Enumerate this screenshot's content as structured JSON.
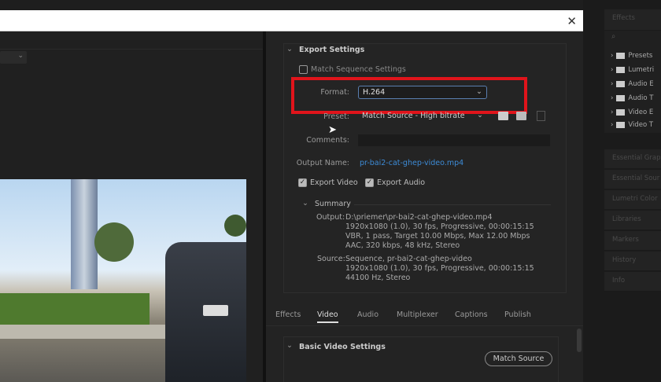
{
  "dialog": {
    "close_icon": "close-icon"
  },
  "export_settings": {
    "title": "Export Settings",
    "match_sequence": "Match Sequence Settings",
    "format_label": "Format:",
    "format_value": "H.264",
    "preset_label": "Preset:",
    "preset_value": "Match Source - High bitrate",
    "comments_label": "Comments:",
    "output_name_label": "Output Name:",
    "output_name_value": "pr-bai2-cat-ghep-video.mp4",
    "export_video": "Export Video",
    "export_audio": "Export Audio",
    "summary": {
      "title": "Summary",
      "output_label": "Output:",
      "output_lines": [
        "D:\\priemer\\pr-bai2-cat-ghep-video.mp4",
        "1920x1080 (1.0), 30 fps, Progressive, 00:00:15:15",
        "VBR, 1 pass, Target 10.00 Mbps, Max 12.00 Mbps",
        "AAC, 320 kbps, 48 kHz, Stereo"
      ],
      "source_label": "Source:",
      "source_lines": [
        "Sequence, pr-bai2-cat-ghep-video",
        "1920x1080 (1.0), 30 fps, Progressive, 00:00:15:15",
        "44100 Hz, Stereo"
      ]
    }
  },
  "tabs": [
    "Effects",
    "Video",
    "Audio",
    "Multiplexer",
    "Captions",
    "Publish"
  ],
  "active_tab": "Video",
  "basic_video": {
    "title": "Basic Video Settings",
    "match_source": "Match Source"
  },
  "accent": "#3d8bd6",
  "highlight": "#e0141b",
  "sidebar": {
    "effects_title": "Effects",
    "folders": [
      "Presets",
      "Lumetri",
      "Audio E",
      "Audio T",
      "Video E",
      "Video T"
    ],
    "panels": [
      "Essential Grap",
      "Essential Sour",
      "Lumetri Color",
      "Libraries",
      "Markers",
      "History",
      "Info"
    ]
  }
}
